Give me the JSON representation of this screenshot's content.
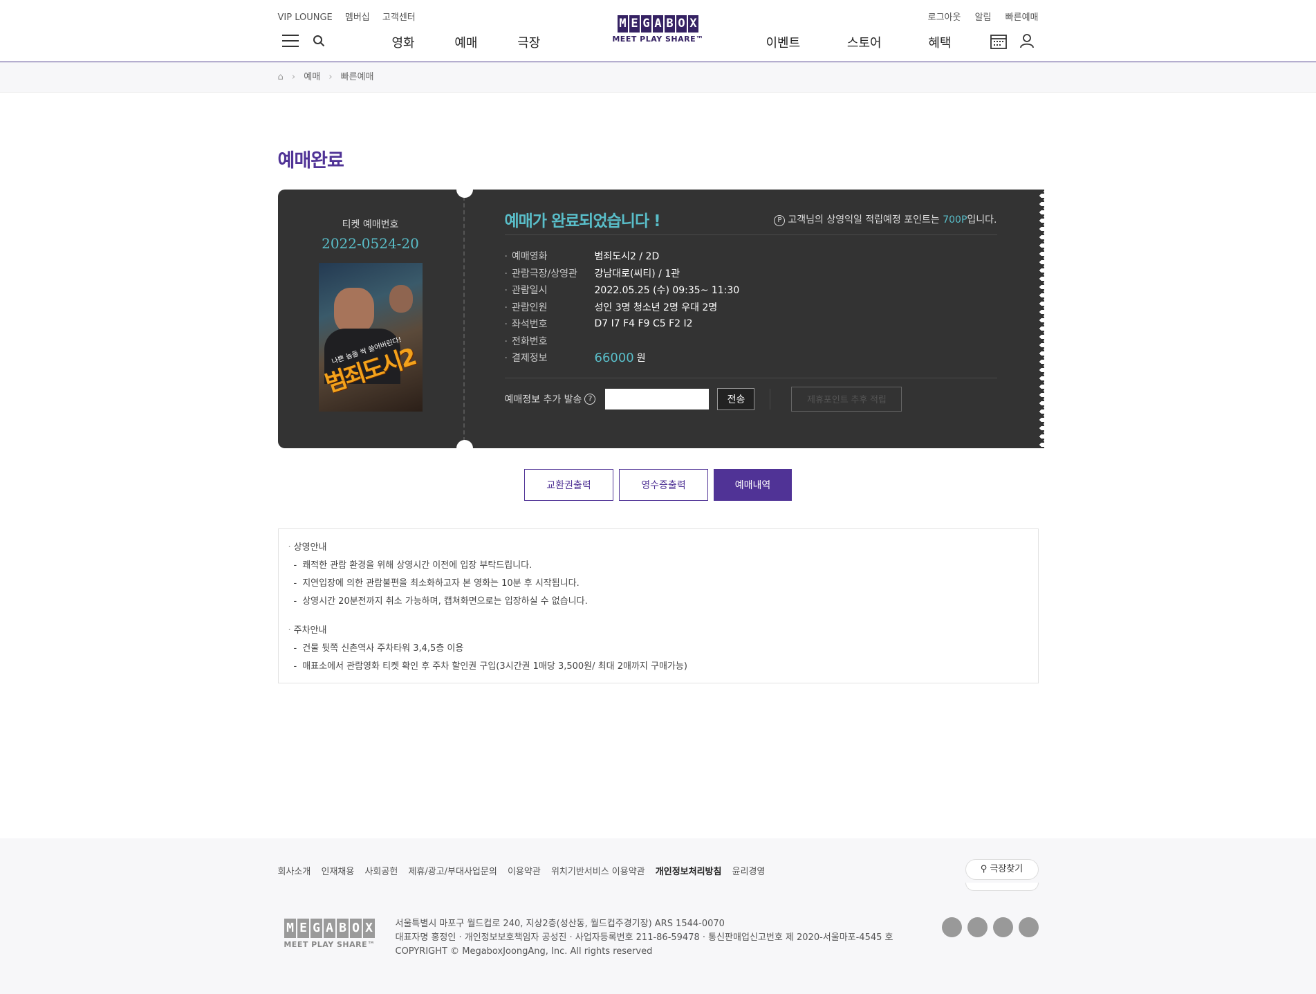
{
  "header": {
    "top_left": [
      "VIP LOUNGE",
      "멤버십",
      "고객센터"
    ],
    "top_right": [
      "로그아웃",
      "알림",
      "빠른예매"
    ],
    "logo_letters": [
      "M",
      "E",
      "G",
      "A",
      "B",
      "O",
      "X"
    ],
    "logo_tagline": "MEET PLAY SHARE™",
    "nav_left": [
      "영화",
      "예매",
      "극장"
    ],
    "nav_right": [
      "이벤트",
      "스토어",
      "혜택"
    ]
  },
  "breadcrumb": [
    "예매",
    "빠른예매"
  ],
  "page_title": "예매완료",
  "ticket": {
    "number_label": "티켓 예매번호",
    "number": "2022-0524-20",
    "done_text": "예매가 완료되었습니다 !",
    "points_prefix": "고객님의 상영익일 적립예정 포인트는 ",
    "points_value": "700P",
    "points_suffix": "입니다.",
    "rows": [
      {
        "label": "예매영화",
        "value": "범죄도시2 / 2D"
      },
      {
        "label": "관람극장/상영관",
        "value": "강남대로(씨티) / 1관"
      },
      {
        "label": "관람일시",
        "value": "2022.05.25 (수) 09:35~ 11:30"
      },
      {
        "label": "관람인원",
        "value": "성인 3명 청소년 2명 우대 2명"
      },
      {
        "label": "좌석번호",
        "value": "D7 I7 F4 F9 C5 F2 I2"
      },
      {
        "label": "전화번호",
        "value": ""
      },
      {
        "label": "결제정보",
        "value": "66000"
      }
    ],
    "currency": "원",
    "send_label": "예매정보 추가 발송",
    "send_button": "전송",
    "partner_button": "제휴포인트 추후 적립",
    "poster_title": "범죄도시2",
    "poster_sub": "나쁜 놈들 싹 쓸어버린다!"
  },
  "buttons": {
    "exchange": "교환권출력",
    "receipt": "영수증출력",
    "history": "예매내역"
  },
  "notice": {
    "section1_title": "상영안내",
    "section1_items": [
      "쾌적한 관람 환경을 위해 상영시간 이전에 입장 부탁드립니다.",
      "지연입장에 의한 관람불편을 최소화하고자 본 영화는 10분 후 시작됩니다.",
      "상영시간 20분전까지 취소 가능하며, 캡쳐화면으로는 입장하실 수 없습니다."
    ],
    "section2_title": "주차안내",
    "section2_items": [
      "건물 뒷쪽 신촌역사 주차타워 3,4,5층 이용",
      "매표소에서 관람영화 티켓 확인 후 주차 할인권 구입(3시간권 1매당 3,500원/ 최대 2매까지 구매가능)"
    ]
  },
  "footer": {
    "links": [
      "회사소개",
      "인재채용",
      "사회공헌",
      "제휴/광고/부대사업문의",
      "이용약관",
      "위치기반서비스 이용약관",
      "개인정보처리방침",
      "윤리경영"
    ],
    "find_theater": "극장찾기",
    "address": "서울특별시 마포구 월드컵로 240, 지상2층(성산동, 월드컵주경기장) ARS 1544-0070",
    "company": "대표자명 홍정인 · 개인정보보호책임자 공성진 · 사업자등록번호 211-86-59478 · 통신판매업신고번호 제 2020-서울마포-4545 호",
    "copyright": "COPYRIGHT © MegaboxJoongAng, Inc. All rights reserved"
  },
  "colors": {
    "brand": "#503396",
    "accent": "#59bec9",
    "ticket_bg": "#333333"
  }
}
